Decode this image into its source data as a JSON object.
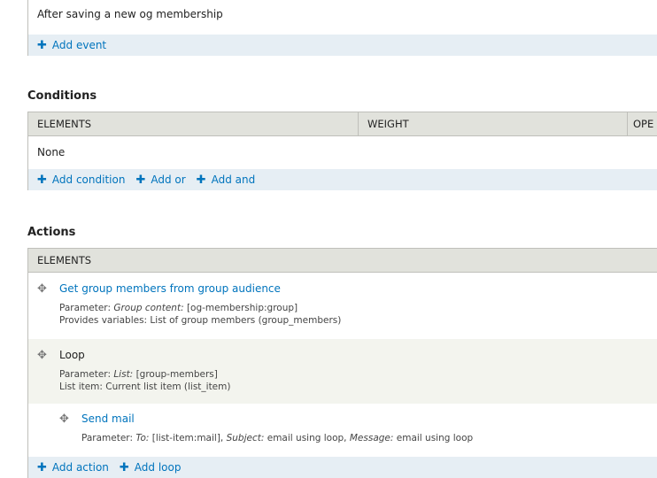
{
  "events": {
    "items": [
      "After saving a new og membership"
    ],
    "add_event": "Add event"
  },
  "conditions": {
    "heading": "Conditions",
    "columns": [
      "ELEMENTS",
      "WEIGHT",
      "OPE"
    ],
    "empty": "None",
    "links": [
      "Add condition",
      "Add or",
      "Add and"
    ]
  },
  "actions": {
    "heading": "Actions",
    "columns": [
      "ELEMENTS"
    ],
    "items": [
      {
        "title": "Get group members from group audience",
        "p1_label": "Parameter: ",
        "p1_key": "Group content:",
        "p1_val": " [og-membership:group]",
        "line2": "Provides variables: List of group members (group_members)"
      },
      {
        "title": "Loop",
        "p1_label": "Parameter: ",
        "p1_key": "List:",
        "p1_val": " [group-members]",
        "line2": "List item: Current list item (list_item)"
      },
      {
        "title": "Send mail",
        "p1_label": "Parameter: ",
        "k1": "To:",
        "v1": " [list-item:mail], ",
        "k2": "Subject:",
        "v2": " email using loop, ",
        "k3": "Message:",
        "v3": " email using loop"
      }
    ],
    "links": [
      "Add action",
      "Add loop"
    ]
  },
  "colors": {
    "link": "#0074bd",
    "footer": "#e6eef4",
    "header": "#e1e2dc",
    "loop_row": "#f3f4ee"
  }
}
